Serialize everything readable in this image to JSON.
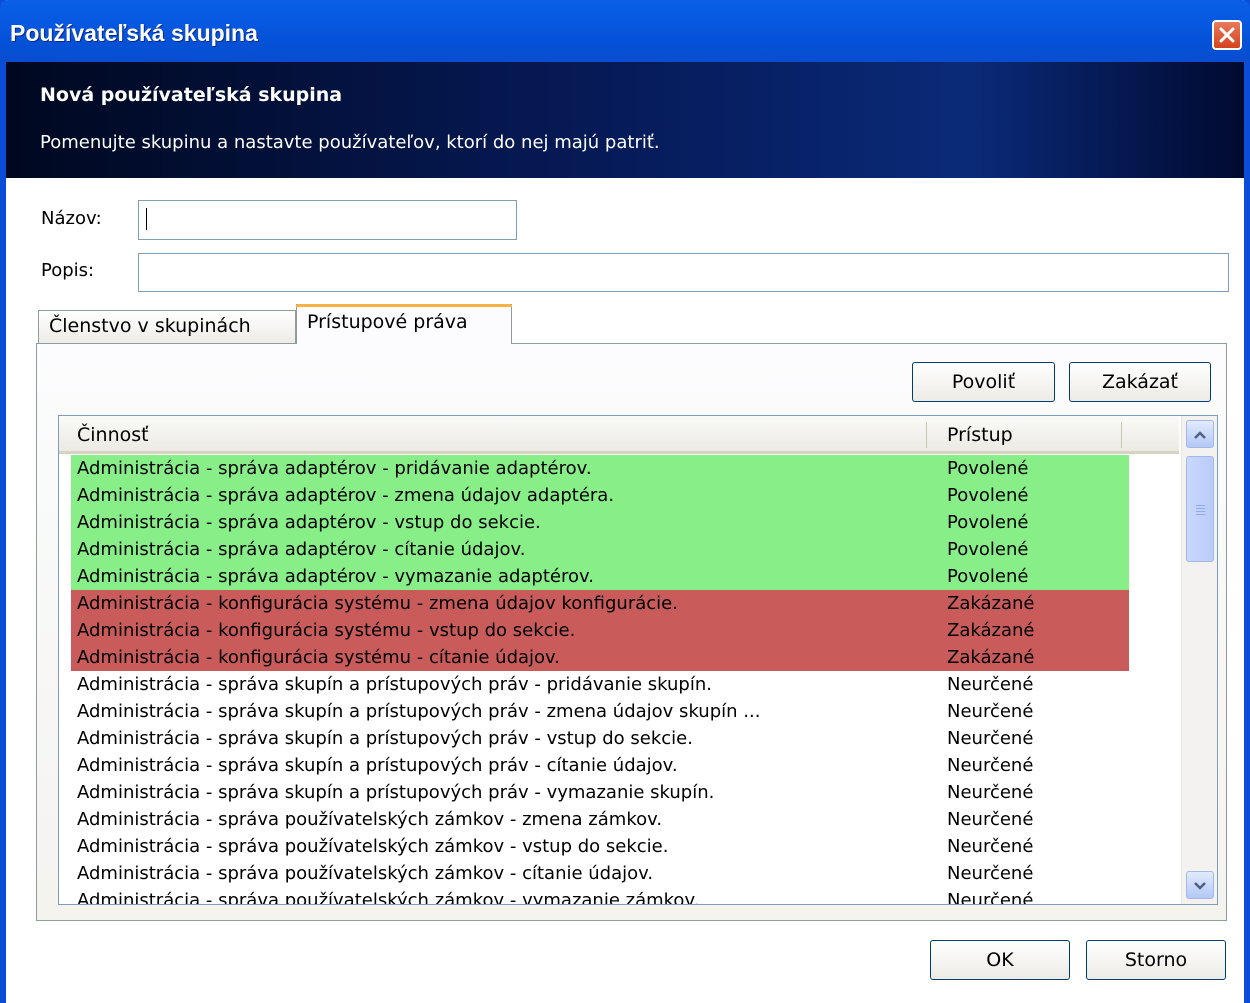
{
  "window": {
    "title": "Používateľská skupina"
  },
  "header": {
    "title": "Nová používateľská skupina",
    "subtitle": "Pomenujte skupinu a nastavte používateľov, ktorí do nej majú patriť."
  },
  "form": {
    "name_label": "Názov:",
    "name_value": "",
    "description_label": "Popis:",
    "description_value": ""
  },
  "tabs": [
    {
      "label": "Členstvo v skupinách",
      "active": false
    },
    {
      "label": "Prístupové práva",
      "active": true
    }
  ],
  "actions": {
    "allow_label": "Povoliť",
    "deny_label": "Zakázať"
  },
  "table": {
    "columns": [
      "Činnosť",
      "Prístup"
    ],
    "rows": [
      {
        "activity": "Administrácia - správa adaptérov - pridávanie adaptérov.",
        "access": "Povolené",
        "state": "allowed"
      },
      {
        "activity": "Administrácia - správa adaptérov - zmena údajov adaptéra.",
        "access": "Povolené",
        "state": "allowed"
      },
      {
        "activity": "Administrácia - správa adaptérov - vstup do sekcie.",
        "access": "Povolené",
        "state": "allowed"
      },
      {
        "activity": "Administrácia - správa adaptérov - cítanie údajov.",
        "access": "Povolené",
        "state": "allowed"
      },
      {
        "activity": "Administrácia - správa adaptérov - vymazanie adaptérov.",
        "access": "Povolené",
        "state": "allowed"
      },
      {
        "activity": "Administrácia - konfigurácia systému - zmena údajov konfigurácie.",
        "access": "Zakázané",
        "state": "denied"
      },
      {
        "activity": "Administrácia - konfigurácia systému - vstup do sekcie.",
        "access": "Zakázané",
        "state": "denied"
      },
      {
        "activity": "Administrácia - konfigurácia systému - cítanie údajov.",
        "access": "Zakázané",
        "state": "denied"
      },
      {
        "activity": "Administrácia - správa skupín a prístupových práv - pridávanie skupín.",
        "access": "Neurčené",
        "state": "unset"
      },
      {
        "activity": "Administrácia - správa skupín a prístupových práv - zmena údajov skupín ...",
        "access": "Neurčené",
        "state": "unset"
      },
      {
        "activity": "Administrácia - správa skupín a prístupových práv - vstup do sekcie.",
        "access": "Neurčené",
        "state": "unset"
      },
      {
        "activity": "Administrácia - správa skupín a prístupových práv - cítanie údajov.",
        "access": "Neurčené",
        "state": "unset"
      },
      {
        "activity": "Administrácia - správa skupín a prístupových práv - vymazanie skupín.",
        "access": "Neurčené",
        "state": "unset"
      },
      {
        "activity": "Administrácia - správa používatelských zámkov - zmena zámkov.",
        "access": "Neurčené",
        "state": "unset"
      },
      {
        "activity": "Administrácia - správa používatelských zámkov - vstup do sekcie.",
        "access": "Neurčené",
        "state": "unset"
      },
      {
        "activity": "Administrácia - správa používatelských zámkov - cítanie údajov.",
        "access": "Neurčené",
        "state": "unset"
      },
      {
        "activity": "Administrácia - správa používatelských zámkov - vymazanie zámkov.",
        "access": "Neurčené",
        "state": "unset"
      }
    ]
  },
  "footer": {
    "ok_label": "OK",
    "cancel_label": "Storno"
  },
  "colors": {
    "allowed_row": "#88ee88",
    "denied_row": "#c95b5b",
    "title_bar": "#0757e0",
    "header_band": "#061b5a",
    "active_tab_accent": "#f9b242"
  },
  "icons": {
    "close": "close-icon",
    "scroll_up": "chevron-up-icon",
    "scroll_down": "chevron-down-icon",
    "scroll_grip": "grip-icon"
  }
}
